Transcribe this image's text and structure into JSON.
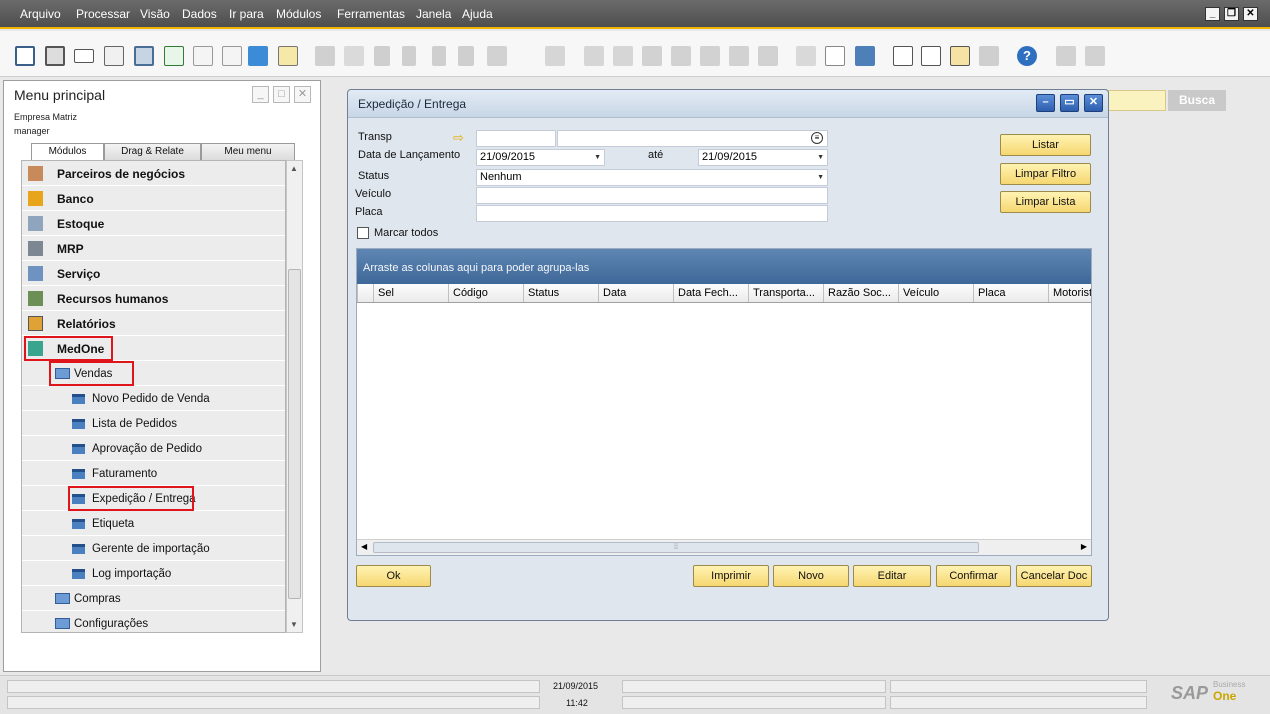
{
  "menu": [
    "Arquivo",
    "Processar",
    "Visão",
    "Dados",
    "Ir para",
    "Módulos",
    "Ferramentas",
    "Janela",
    "Ajuda"
  ],
  "toolbar_icons": [
    "print-preview-icon",
    "print-icon",
    "email-icon",
    "sms-icon",
    "fax-icon",
    "excel-icon",
    "word-icon",
    "pdf-icon",
    "launch-icon",
    "lock-icon",
    "find-icon",
    "add-icon",
    "first-record-icon",
    "previous-record-icon",
    "next-record-icon",
    "last-record-icon",
    "refresh-icon",
    "sort-icon",
    "base-document-icon",
    "target-document-icon",
    "journal-icon",
    "payment-icon",
    "gross-profit-icon",
    "settings-icon",
    "query-icon",
    "layout-icon",
    "form-settings-icon",
    "calendar-icon",
    "messages-icon",
    "alerts-icon",
    "relationship-icon",
    "help-icon",
    "reports-icon",
    "print-layout-icon"
  ],
  "left_panel": {
    "title": "Menu principal",
    "company": "Empresa Matriz",
    "user": "manager",
    "tabs": [
      "Módulos",
      "Drag & Relate",
      "Meu menu"
    ],
    "items": [
      {
        "label": "Parceiros de negócios",
        "icon": "people-icon"
      },
      {
        "label": "Banco",
        "icon": "bank-icon"
      },
      {
        "label": "Estoque",
        "icon": "inventory-icon"
      },
      {
        "label": "MRP",
        "icon": "mrp-icon"
      },
      {
        "label": "Serviço",
        "icon": "wrench-icon"
      },
      {
        "label": "Recursos humanos",
        "icon": "hr-icon"
      },
      {
        "label": "Relatórios",
        "icon": "report-icon"
      },
      {
        "label": "MedOne",
        "icon": "cube-icon"
      },
      {
        "label": "Vendas",
        "icon": "folder-open-icon"
      },
      {
        "label": "Novo Pedido de Venda",
        "icon": "form-icon"
      },
      {
        "label": "Lista de Pedidos",
        "icon": "form-icon"
      },
      {
        "label": "Aprovação de Pedido",
        "icon": "form-icon"
      },
      {
        "label": "Faturamento",
        "icon": "form-icon"
      },
      {
        "label": "Expedição / Entrega",
        "icon": "form-icon"
      },
      {
        "label": "Etiqueta",
        "icon": "form-icon"
      },
      {
        "label": "Gerente de importação",
        "icon": "form-icon"
      },
      {
        "label": "Log importação",
        "icon": "form-icon"
      },
      {
        "label": "Compras",
        "icon": "folder-icon"
      },
      {
        "label": "Configurações",
        "icon": "folder-icon"
      }
    ]
  },
  "search": {
    "button": "Busca"
  },
  "dialog": {
    "title": "Expedição / Entrega",
    "fields": {
      "transp_label": "Transp",
      "data_label": "Data de Lançamento",
      "data_from": "21/09/2015",
      "ate_label": "até",
      "data_to": "21/09/2015",
      "status_label": "Status",
      "status_value": "Nenhum",
      "veiculo_label": "Veículo",
      "placa_label": "Placa",
      "marcar_label": "Marcar todos"
    },
    "side_buttons": [
      "Listar",
      "Limpar Filtro",
      "Limpar Lista"
    ],
    "grid": {
      "group_hint": "Arraste as colunas aqui para poder agrupa-las",
      "columns": [
        "Sel",
        "Código",
        "Status",
        "Data",
        "Data Fech...",
        "Transporta...",
        "Razão Soc...",
        "Veículo",
        "Placa",
        "Motorista"
      ]
    },
    "bottom_buttons": {
      "ok": "Ok",
      "imprimir": "Imprimir",
      "novo": "Novo",
      "editar": "Editar",
      "confirmar": "Confirmar",
      "cancelar": "Cancelar Doc"
    }
  },
  "status": {
    "date": "21/09/2015",
    "time": "11:42"
  },
  "brand": {
    "sap": "SAP",
    "business": "Business",
    "one": "One"
  }
}
